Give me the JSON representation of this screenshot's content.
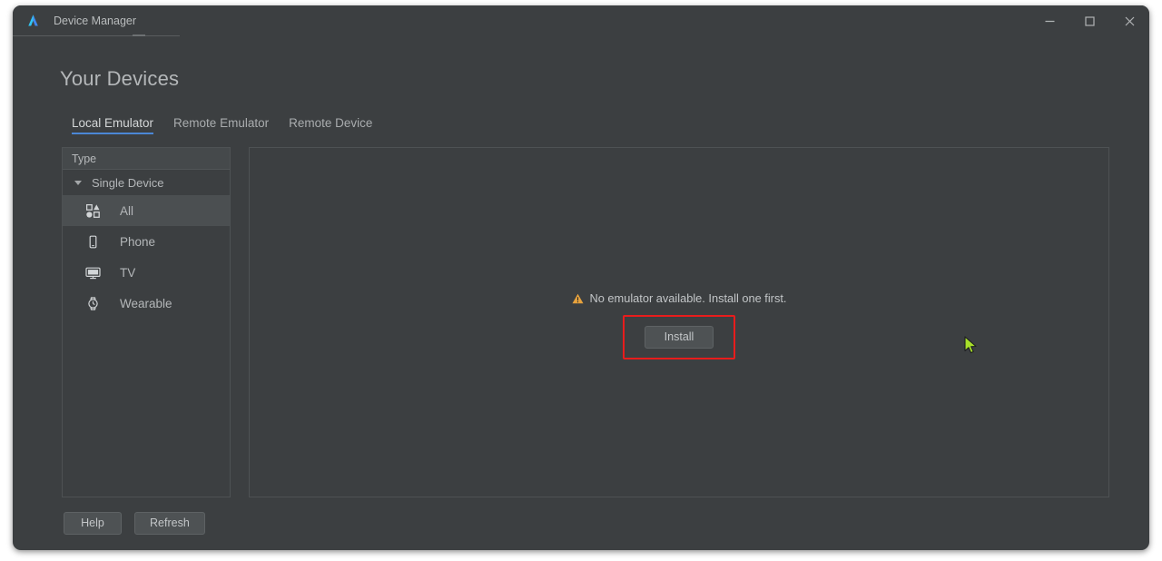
{
  "window": {
    "title": "Device Manager",
    "app_icon": "android-studio-logo-icon",
    "controls": {
      "minimize": "minimize-icon",
      "maximize": "maximize-icon",
      "close": "close-icon"
    }
  },
  "page": {
    "heading": "Your Devices"
  },
  "tabs": [
    {
      "label": "Local Emulator",
      "active": true
    },
    {
      "label": "Remote Emulator",
      "active": false
    },
    {
      "label": "Remote Device",
      "active": false
    }
  ],
  "sidebar": {
    "header": "Type",
    "group": {
      "label": "Single Device",
      "expanded": true
    },
    "items": [
      {
        "label": "All",
        "icon": "all-shapes-icon",
        "selected": true
      },
      {
        "label": "Phone",
        "icon": "phone-icon",
        "selected": false
      },
      {
        "label": "TV",
        "icon": "tv-icon",
        "selected": false
      },
      {
        "label": "Wearable",
        "icon": "watch-icon",
        "selected": false
      }
    ]
  },
  "main": {
    "empty_message": "No emulator available. Install one first.",
    "warning_icon": "warning-triangle-icon",
    "install_label": "Install",
    "install_highlighted": true
  },
  "footer": {
    "help_label": "Help",
    "refresh_label": "Refresh"
  },
  "colors": {
    "background": "#3c3f41",
    "panel_border": "#4e5254",
    "accent_tab": "#4b87d6",
    "highlight_box": "#e81c1c",
    "warning": "#e8a33d",
    "selected_row": "#4b4f51",
    "cursor": "#a8e02a"
  }
}
